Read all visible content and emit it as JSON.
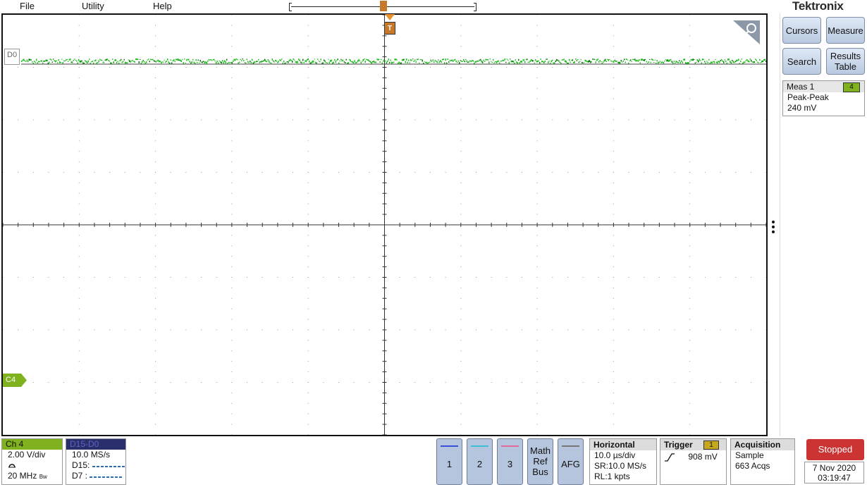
{
  "menu": {
    "file": "File",
    "utility": "Utility",
    "help": "Help"
  },
  "brand": "Tektronix",
  "display": {
    "digital_label": "D0",
    "channel_label": "C4",
    "trigger_marker": "T",
    "colors": {
      "trace": "#22c022",
      "channel4": "#7fb21e",
      "trigger": "#c8782a"
    }
  },
  "right_panel": {
    "cursors": "Cursors",
    "measure": "Measure",
    "search": "Search",
    "results_table_1": "Results",
    "results_table_2": "Table",
    "meas": {
      "title": "Meas 1",
      "channel": "4",
      "type": "Peak-Peak",
      "value": "240 mV"
    }
  },
  "bottom": {
    "ch4": {
      "title": "Ch 4",
      "scale": "2.00 V/div",
      "bw": "20 MHz",
      "bw_suffix": "Bw"
    },
    "dbus": {
      "title": "D15-D0",
      "rate": "10.0 MS/s",
      "d15_label": "D15:",
      "d7_label": "D7 :"
    },
    "channel_buttons": [
      "1",
      "2",
      "3"
    ],
    "math_ref_bus": [
      "Math",
      "Ref",
      "Bus"
    ],
    "afg": "AFG",
    "horizontal": {
      "title": "Horizontal",
      "scale": "10.0 µs/div",
      "sr": "SR:10.0 MS/s",
      "rl": "RL:1 kpts"
    },
    "trigger": {
      "title": "Trigger",
      "channel": "1",
      "level": "908 mV"
    },
    "acquisition": {
      "title": "Acquisition",
      "mode": "Sample",
      "count": "663 Acqs"
    },
    "stopped": "Stopped",
    "date": "7 Nov 2020",
    "time": "03:19:47"
  }
}
